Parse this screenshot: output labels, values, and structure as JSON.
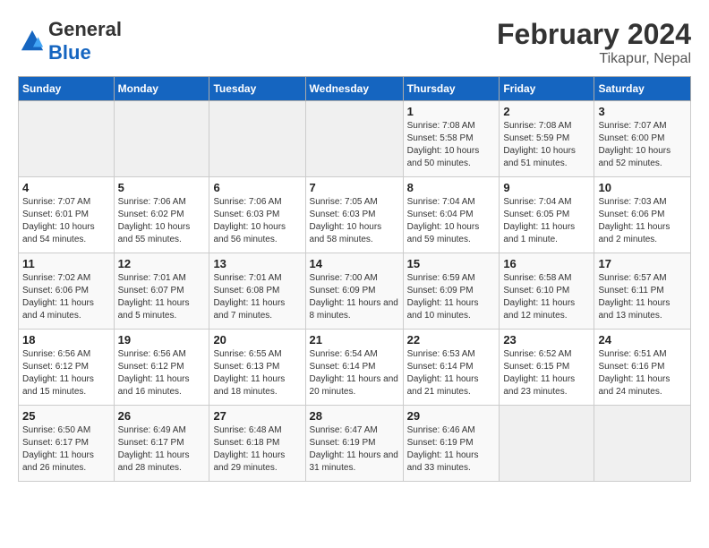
{
  "logo": {
    "general": "General",
    "blue": "Blue"
  },
  "title": "February 2024",
  "subtitle": "Tikapur, Nepal",
  "headers": [
    "Sunday",
    "Monday",
    "Tuesday",
    "Wednesday",
    "Thursday",
    "Friday",
    "Saturday"
  ],
  "weeks": [
    [
      {
        "empty": true
      },
      {
        "empty": true
      },
      {
        "empty": true
      },
      {
        "empty": true
      },
      {
        "day": 1,
        "sunrise": "7:08 AM",
        "sunset": "5:58 PM",
        "daylight": "10 hours and 50 minutes."
      },
      {
        "day": 2,
        "sunrise": "7:08 AM",
        "sunset": "5:59 PM",
        "daylight": "10 hours and 51 minutes."
      },
      {
        "day": 3,
        "sunrise": "7:07 AM",
        "sunset": "6:00 PM",
        "daylight": "10 hours and 52 minutes."
      }
    ],
    [
      {
        "day": 4,
        "sunrise": "7:07 AM",
        "sunset": "6:01 PM",
        "daylight": "10 hours and 54 minutes."
      },
      {
        "day": 5,
        "sunrise": "7:06 AM",
        "sunset": "6:02 PM",
        "daylight": "10 hours and 55 minutes."
      },
      {
        "day": 6,
        "sunrise": "7:06 AM",
        "sunset": "6:03 PM",
        "daylight": "10 hours and 56 minutes."
      },
      {
        "day": 7,
        "sunrise": "7:05 AM",
        "sunset": "6:03 PM",
        "daylight": "10 hours and 58 minutes."
      },
      {
        "day": 8,
        "sunrise": "7:04 AM",
        "sunset": "6:04 PM",
        "daylight": "10 hours and 59 minutes."
      },
      {
        "day": 9,
        "sunrise": "7:04 AM",
        "sunset": "6:05 PM",
        "daylight": "11 hours and 1 minute."
      },
      {
        "day": 10,
        "sunrise": "7:03 AM",
        "sunset": "6:06 PM",
        "daylight": "11 hours and 2 minutes."
      }
    ],
    [
      {
        "day": 11,
        "sunrise": "7:02 AM",
        "sunset": "6:06 PM",
        "daylight": "11 hours and 4 minutes."
      },
      {
        "day": 12,
        "sunrise": "7:01 AM",
        "sunset": "6:07 PM",
        "daylight": "11 hours and 5 minutes."
      },
      {
        "day": 13,
        "sunrise": "7:01 AM",
        "sunset": "6:08 PM",
        "daylight": "11 hours and 7 minutes."
      },
      {
        "day": 14,
        "sunrise": "7:00 AM",
        "sunset": "6:09 PM",
        "daylight": "11 hours and 8 minutes."
      },
      {
        "day": 15,
        "sunrise": "6:59 AM",
        "sunset": "6:09 PM",
        "daylight": "11 hours and 10 minutes."
      },
      {
        "day": 16,
        "sunrise": "6:58 AM",
        "sunset": "6:10 PM",
        "daylight": "11 hours and 12 minutes."
      },
      {
        "day": 17,
        "sunrise": "6:57 AM",
        "sunset": "6:11 PM",
        "daylight": "11 hours and 13 minutes."
      }
    ],
    [
      {
        "day": 18,
        "sunrise": "6:56 AM",
        "sunset": "6:12 PM",
        "daylight": "11 hours and 15 minutes."
      },
      {
        "day": 19,
        "sunrise": "6:56 AM",
        "sunset": "6:12 PM",
        "daylight": "11 hours and 16 minutes."
      },
      {
        "day": 20,
        "sunrise": "6:55 AM",
        "sunset": "6:13 PM",
        "daylight": "11 hours and 18 minutes."
      },
      {
        "day": 21,
        "sunrise": "6:54 AM",
        "sunset": "6:14 PM",
        "daylight": "11 hours and 20 minutes."
      },
      {
        "day": 22,
        "sunrise": "6:53 AM",
        "sunset": "6:14 PM",
        "daylight": "11 hours and 21 minutes."
      },
      {
        "day": 23,
        "sunrise": "6:52 AM",
        "sunset": "6:15 PM",
        "daylight": "11 hours and 23 minutes."
      },
      {
        "day": 24,
        "sunrise": "6:51 AM",
        "sunset": "6:16 PM",
        "daylight": "11 hours and 24 minutes."
      }
    ],
    [
      {
        "day": 25,
        "sunrise": "6:50 AM",
        "sunset": "6:17 PM",
        "daylight": "11 hours and 26 minutes."
      },
      {
        "day": 26,
        "sunrise": "6:49 AM",
        "sunset": "6:17 PM",
        "daylight": "11 hours and 28 minutes."
      },
      {
        "day": 27,
        "sunrise": "6:48 AM",
        "sunset": "6:18 PM",
        "daylight": "11 hours and 29 minutes."
      },
      {
        "day": 28,
        "sunrise": "6:47 AM",
        "sunset": "6:19 PM",
        "daylight": "11 hours and 31 minutes."
      },
      {
        "day": 29,
        "sunrise": "6:46 AM",
        "sunset": "6:19 PM",
        "daylight": "11 hours and 33 minutes."
      },
      {
        "empty": true
      },
      {
        "empty": true
      }
    ]
  ]
}
